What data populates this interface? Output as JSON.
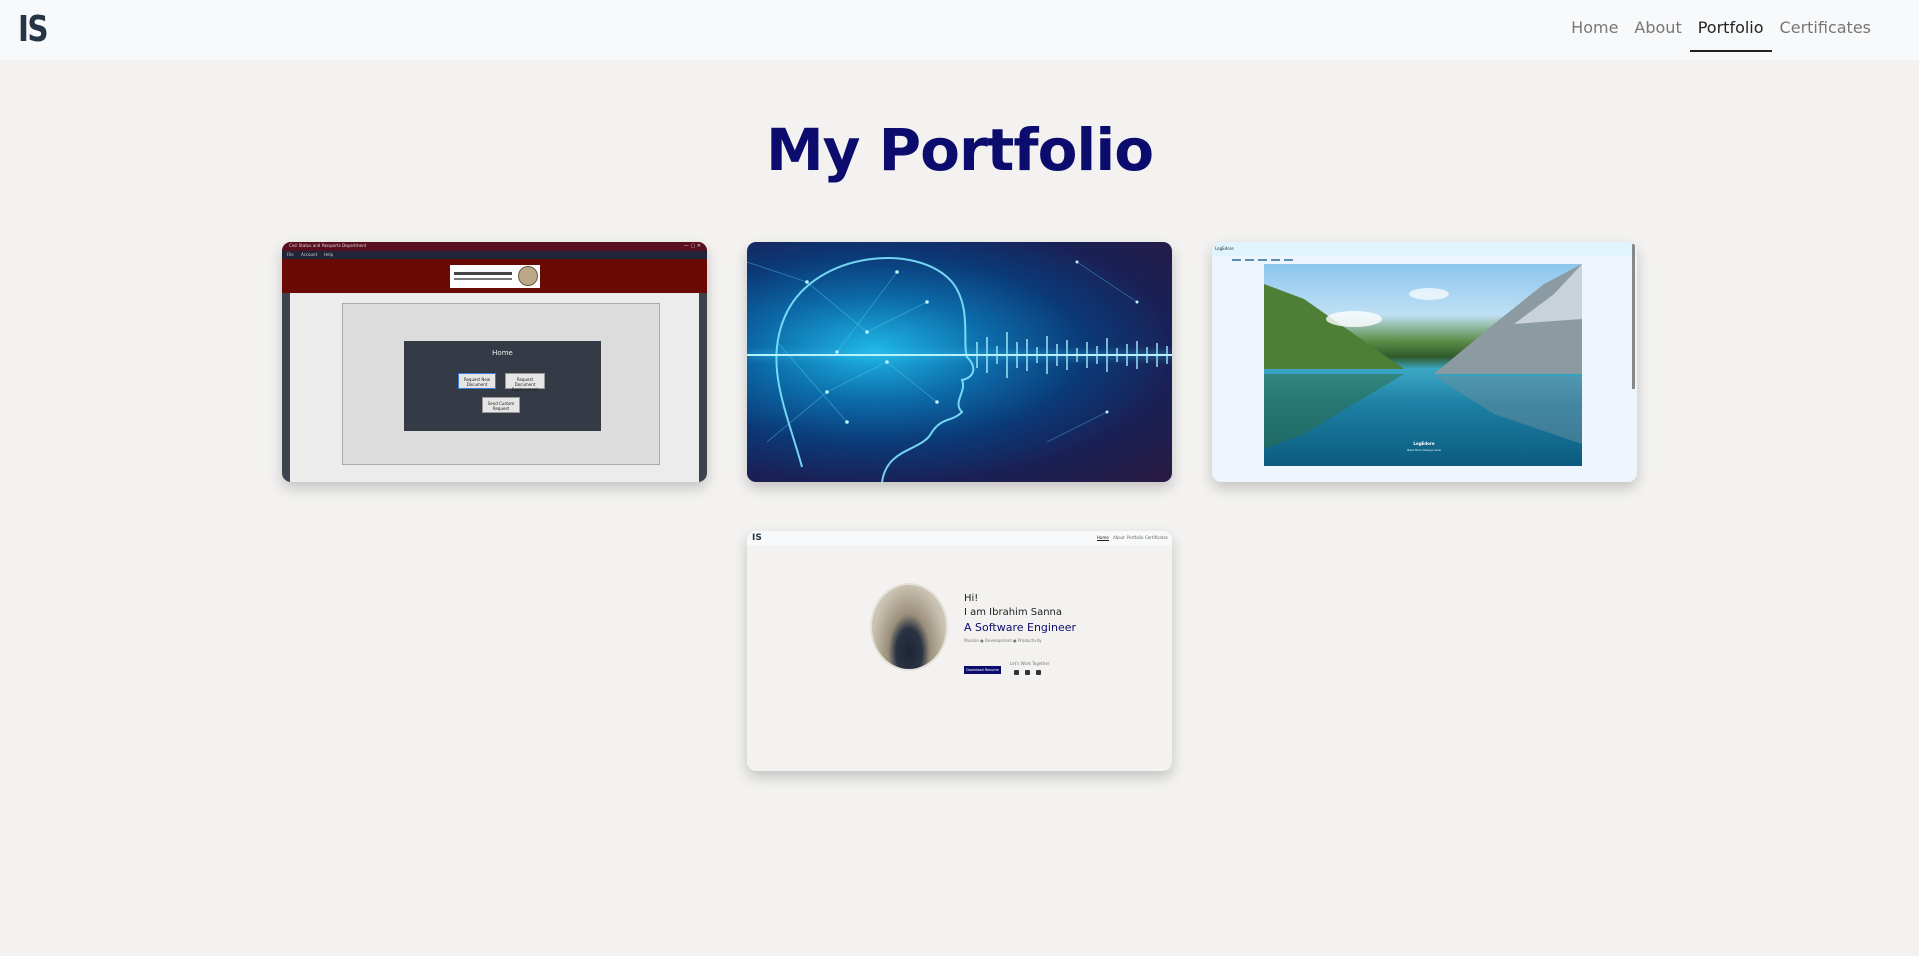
{
  "nav": {
    "logo": "IS",
    "links": [
      "Home",
      "About",
      "Portfolio",
      "Certificates"
    ],
    "active": "Portfolio"
  },
  "page": {
    "title": "My Portfolio"
  },
  "projects": [
    {
      "kind": "desktop-app",
      "window_title": "Civil Status and Passports Department",
      "menu": [
        "File",
        "Account",
        "Help"
      ],
      "panel_title": "Home",
      "buttons": [
        "Request New Document",
        "Request Document Replacement",
        "Send Custom Request"
      ]
    },
    {
      "kind": "ai-voice-image"
    },
    {
      "kind": "website",
      "brand": "LogEdore",
      "caption_title": "LogEdore",
      "caption_sub": "Best Item Always here"
    },
    {
      "kind": "portfolio-site",
      "logo": "IS",
      "nav": [
        "Home",
        "About",
        "Portfolio",
        "Certificates"
      ],
      "greeting": "Hi!",
      "name": "I am Ibrahim Sanna",
      "role": "A Software Engineer",
      "subtitle": "Passion ● Development ● Productivity",
      "cta": "Download Resume",
      "join": "Let's Work Together"
    }
  ]
}
